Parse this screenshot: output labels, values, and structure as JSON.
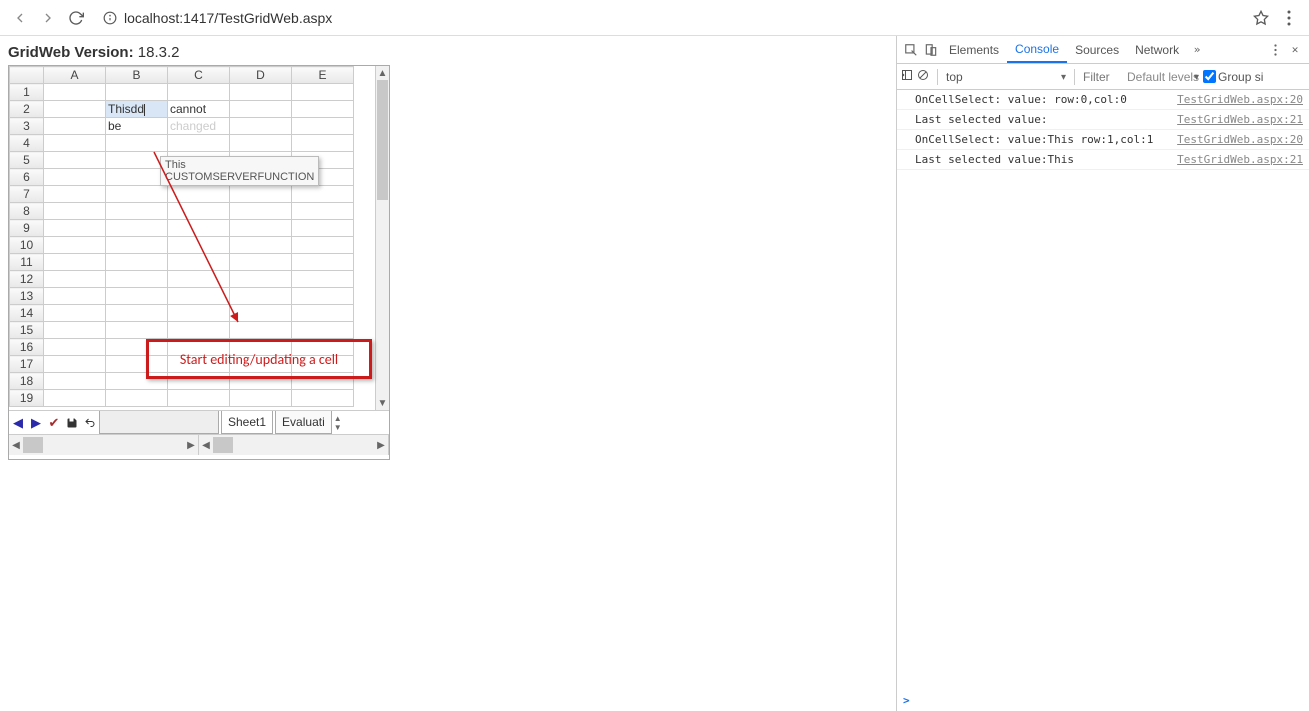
{
  "browser": {
    "address": "localhost:1417/TestGridWeb.aspx"
  },
  "page": {
    "version_label": "GridWeb Version:",
    "version_value": "18.3.2"
  },
  "grid": {
    "columns": [
      "A",
      "B",
      "C",
      "D",
      "E"
    ],
    "rows": [
      "1",
      "2",
      "3",
      "4",
      "5",
      "6",
      "7",
      "8",
      "9",
      "10",
      "11",
      "12",
      "13",
      "14",
      "15",
      "16",
      "17",
      "18",
      "19"
    ],
    "cells": {
      "B2": {
        "value": "Thisdd",
        "editing": true,
        "selected": true
      },
      "C2": {
        "value": "cannot"
      },
      "B3": {
        "value": "be"
      },
      "C3": {
        "value": "changed",
        "faded": true
      }
    },
    "tooltip_line1": "This",
    "tooltip_line2": "CUSTOMSERVERFUNCTION",
    "tabs": [
      "Sheet1",
      "Evaluati"
    ],
    "active_tab": 0
  },
  "annotation": {
    "text": "Start editing/updating a cell"
  },
  "devtools": {
    "tabs": [
      "Elements",
      "Console",
      "Sources",
      "Network"
    ],
    "active_tab": 1,
    "context": "top",
    "filter_placeholder": "Filter",
    "levels_label": "Default levels",
    "group_label": "Group si",
    "messages": [
      {
        "body": "OnCellSelect: value: row:0,col:0",
        "src": "TestGridWeb.aspx:20"
      },
      {
        "body": "Last selected value:",
        "src": "TestGridWeb.aspx:21"
      },
      {
        "body": "OnCellSelect: value:This row:1,col:1",
        "src": "TestGridWeb.aspx:20"
      },
      {
        "body": "Last selected value:This",
        "src": "TestGridWeb.aspx:21"
      }
    ],
    "prompt": ">"
  }
}
